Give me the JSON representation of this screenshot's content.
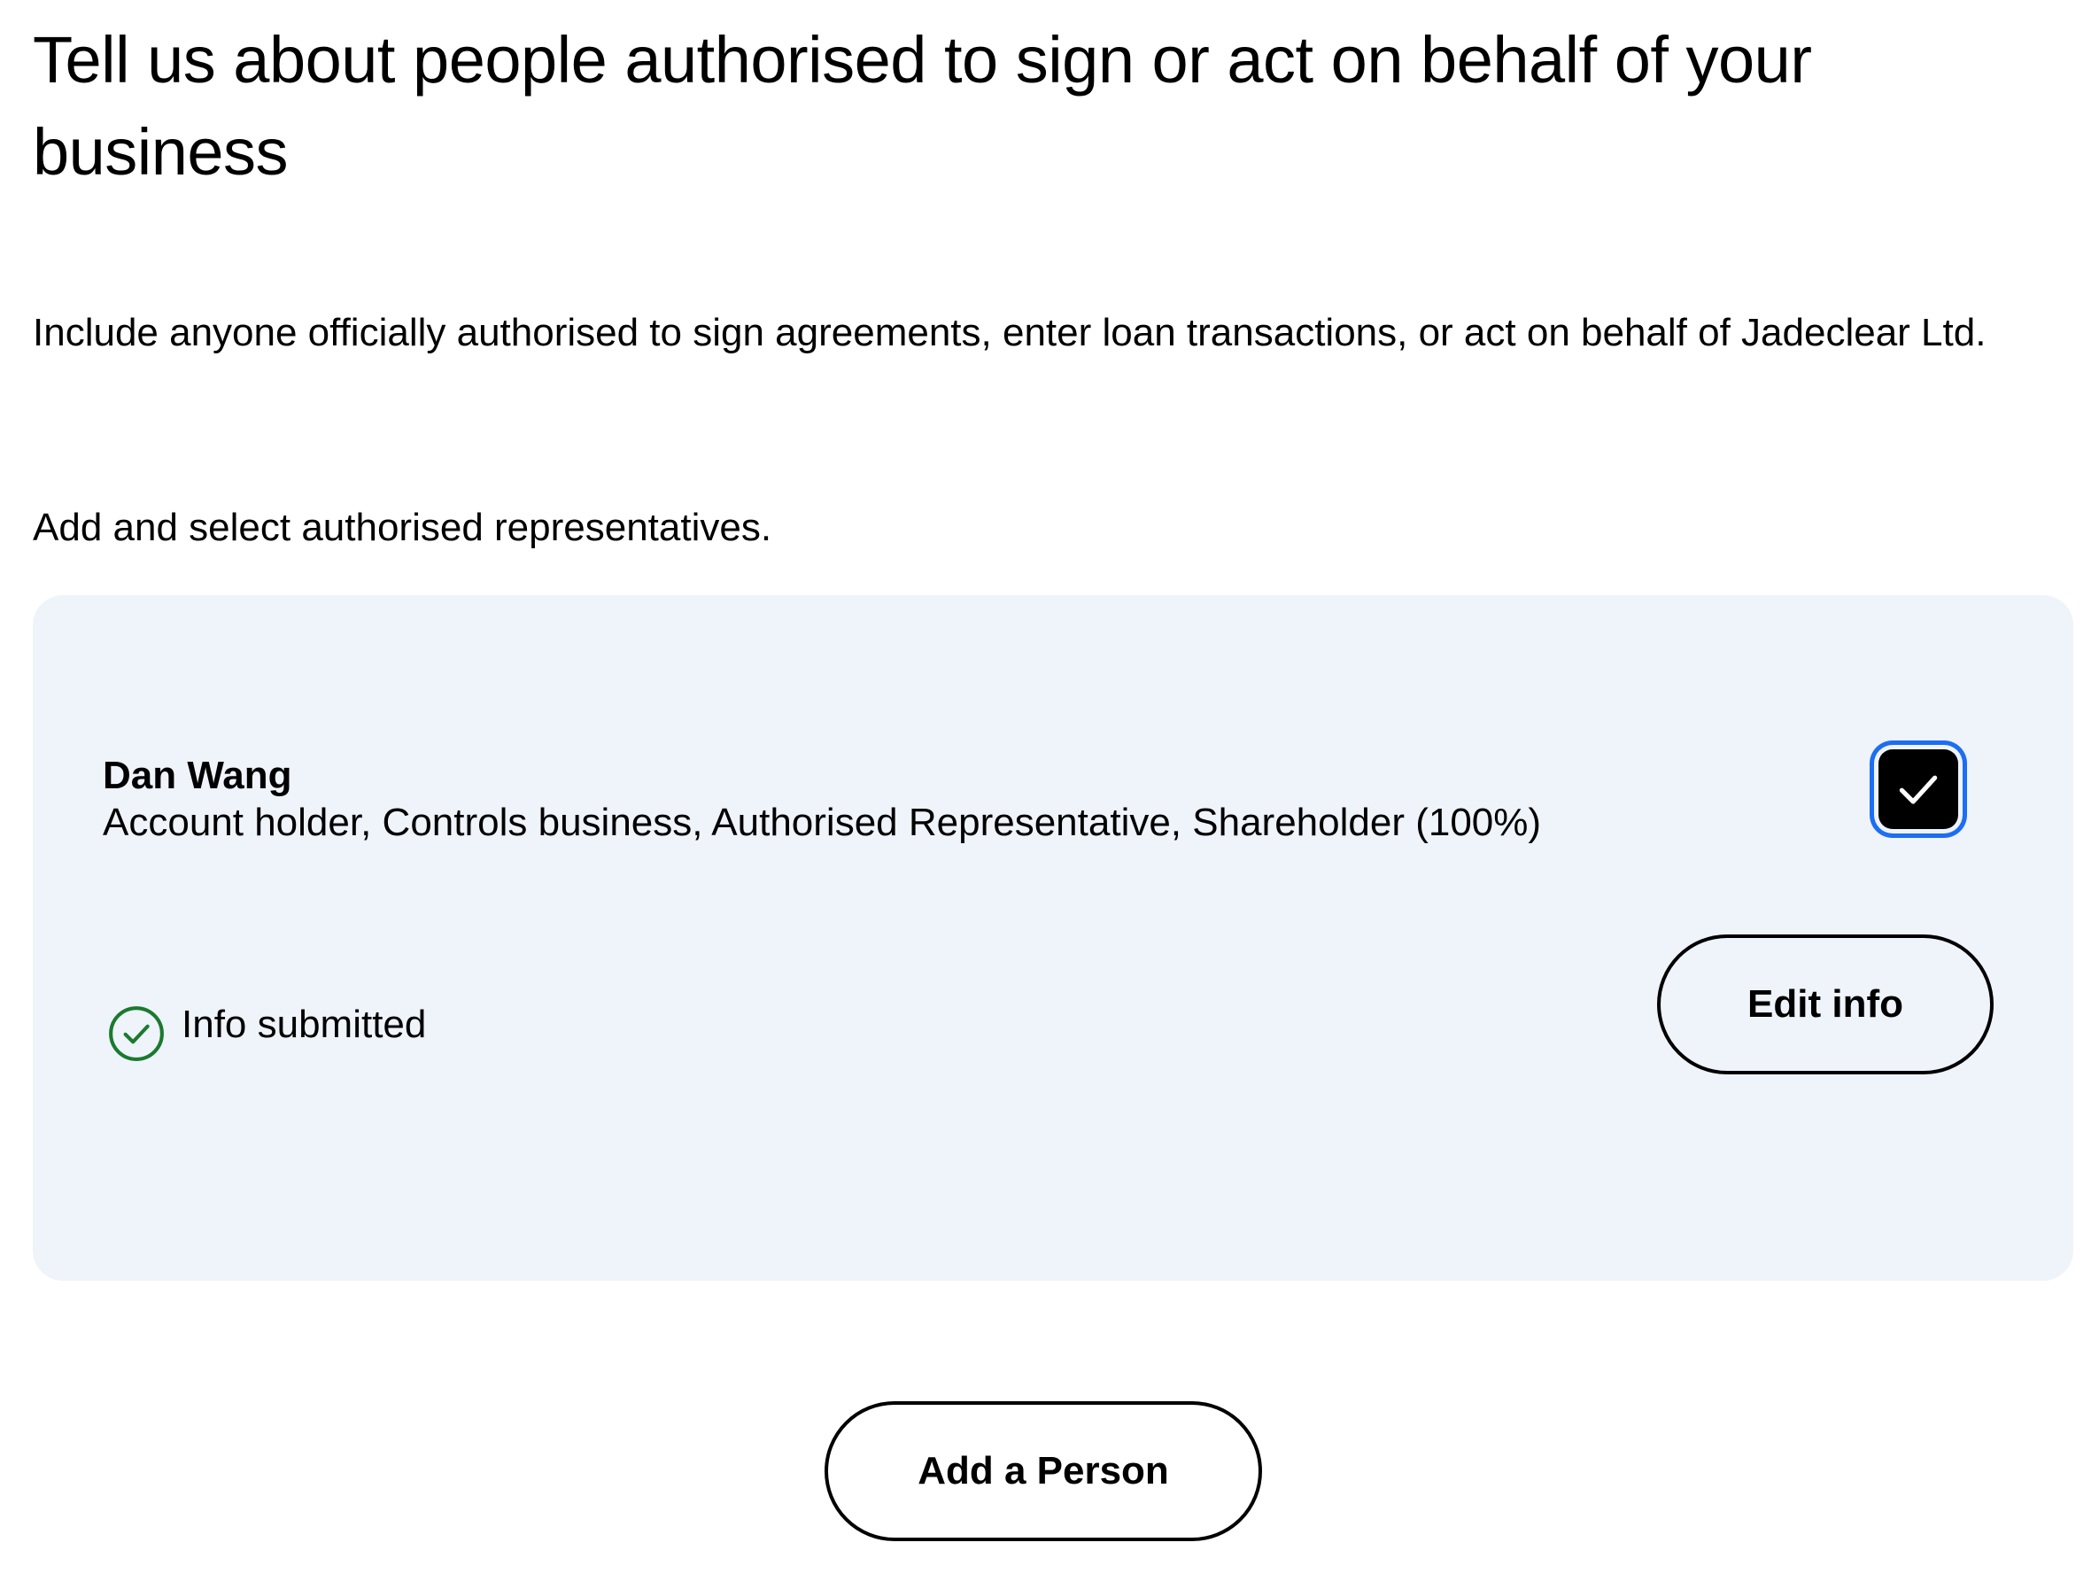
{
  "header": {
    "title": "Tell us about people authorised to sign or act on behalf of your business"
  },
  "intro": {
    "text": "Include anyone officially authorised to sign agreements, enter loan transactions, or act on behalf of Jadeclear Ltd."
  },
  "instruction": {
    "text": "Add and select authorised representatives."
  },
  "people": [
    {
      "name": "Dan Wang",
      "roles": "Account holder,  Controls business,  Authorised Representative,  Shareholder (100%)",
      "selected": true,
      "status": "Info submitted",
      "edit_label": "Edit info"
    }
  ],
  "actions": {
    "add_person_label": "Add a Person"
  },
  "icons": {
    "checkbox_check": "check-icon",
    "status": "check-circle-icon"
  },
  "colors": {
    "card_background": "#eff3fa",
    "focus_ring": "#1c6ef2",
    "success_green": "#1a7a2e"
  }
}
